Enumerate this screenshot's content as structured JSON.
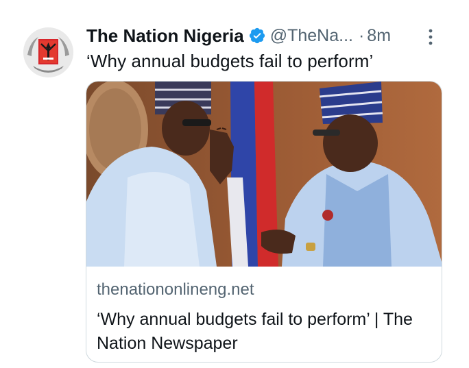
{
  "tweet": {
    "author": {
      "display_name": "The Nation Nigeria",
      "handle": "@TheNa...",
      "verified": true,
      "avatar_icon": "the-nation-logo-icon"
    },
    "separator": "·",
    "timestamp": "8m",
    "text": "‘Why annual budgets fail to perform’",
    "more_icon": "more-vertical-icon",
    "link_card": {
      "domain": "thenationonlineng.net",
      "title": "‘Why annual budgets fail to perform’ | The Nation Newspaper"
    }
  },
  "colors": {
    "verified_blue": "#1d9bf0",
    "secondary_text": "#536471",
    "primary_text": "#0f1419",
    "card_border": "#cfd9de"
  }
}
